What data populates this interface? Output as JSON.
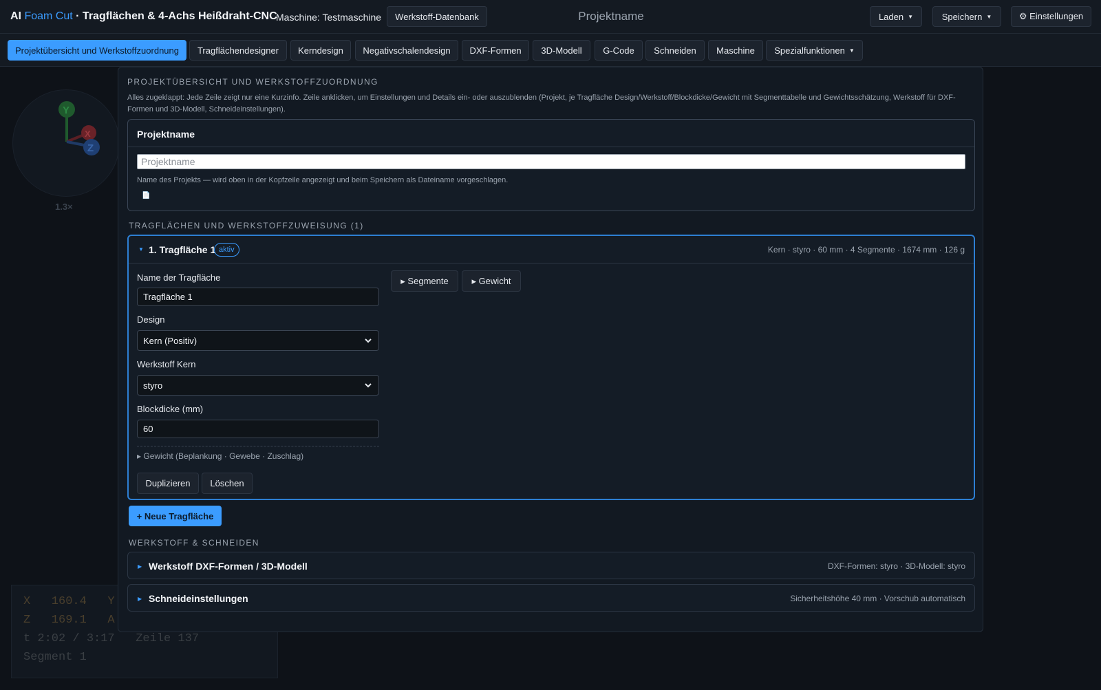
{
  "header": {
    "brand_ai": "AI",
    "brand_accent": "Foam Cut",
    "brand_rest": "· Tragflächen & 4-Achs Heißdraht-CNC",
    "machine": "Maschine: Testmaschine",
    "material_db": "Werkstoff-Datenbank",
    "project_title": "Projektname",
    "load": "Laden",
    "save": "Speichern",
    "settings": "⚙ Einstellungen"
  },
  "tabs": [
    "Projektübersicht und Werkstoffzuordnung",
    "Tragflächendesigner",
    "Kerndesign",
    "Negativschalendesign",
    "DXF-Formen",
    "3D-Modell",
    "G-Code",
    "Schneiden",
    "Maschine",
    "Spezialfunktionen"
  ],
  "background": {
    "gizmo_y": "Y",
    "gizmo_x": "X",
    "gizmo_z": "Z",
    "zoom": "1.3×",
    "dro_line1_a": "X   160.4   Y",
    "dro_line2_a": "Z   169.1   A",
    "dro_line3": "t 2:02 / 3:17   Zeile 137",
    "dro_line4": "Segment 1"
  },
  "overview": {
    "heading": "PROJEKTÜBERSICHT UND WERKSTOFFZUORDNUNG",
    "description": "Alles zugeklappt: Jede Zeile zeigt nur eine Kurzinfo. Zeile anklicken, um Einstellungen und Details ein- oder auszublenden (Projekt, je Tragfläche Design/Werkstoff/Blockdicke/Gewicht mit Segmenttabelle und Gewichtsschätzung, Werkstoff für DXF-Formen und 3D-Modell, Schneideinstellungen).",
    "project_card_title": "Projektname",
    "project_input_placeholder": "Projektname",
    "project_hint": "Name des Projekts — wird oben in der Kopfzeile angezeigt und beim Speichern als Dateiname vorgeschlagen.",
    "doc_icon": "📄"
  },
  "wings": {
    "heading": "TRAGFLÄCHEN UND WERKSTOFFZUWEISUNG (1)",
    "wing1": {
      "title": "1. Tragfläche 1",
      "badge": "aktiv",
      "summary": "Kern · styro · 60 mm · 4 Segmente · 1674 mm · 126 g",
      "name_label": "Name der Tragfläche",
      "name_value": "Tragfläche 1",
      "design_label": "Design",
      "design_value": "Kern (Positiv)",
      "material_label": "Werkstoff Kern",
      "material_value": "styro",
      "thickness_label": "Blockdicke (mm)",
      "thickness_value": "60",
      "weight_toggle": "▸ Gewicht (Beplankung · Gewebe · Zuschlag)",
      "segments_btn": "▸  Segmente",
      "weight_btn": "▸  Gewicht",
      "duplicate": "Duplizieren",
      "delete": "Löschen"
    },
    "new_wing": "+ Neue Tragfläche"
  },
  "material_cut": {
    "heading": "WERKSTOFF & SCHNEIDEN",
    "dxf_title": "Werkstoff DXF-Formen / 3D-Modell",
    "dxf_summary": "DXF-Formen: styro · 3D-Modell: styro",
    "cut_title": "Schneideinstellungen",
    "cut_summary": "Sicherheitshöhe 40 mm · Vorschub automatisch"
  },
  "colors": {
    "accent": "#3b9cff",
    "background": "#0f141b",
    "panel": "#121922"
  }
}
